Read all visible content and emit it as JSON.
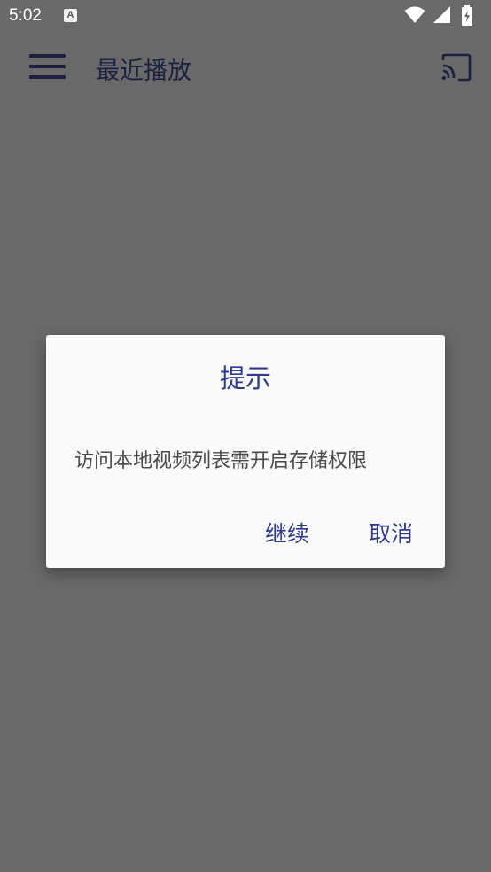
{
  "status_bar": {
    "time": "5:02",
    "notification_letter": "A",
    "icons": [
      "wifi-icon",
      "signal-icon",
      "battery-charging-icon"
    ]
  },
  "toolbar": {
    "title": "最近播放",
    "menu_icon": "hamburger-menu-icon",
    "cast_icon": "cast-icon"
  },
  "dialog": {
    "title": "提示",
    "message": "访问本地视频列表需开启存储权限",
    "continue_label": "继续",
    "cancel_label": "取消"
  },
  "colors": {
    "scrim_background": "#696969",
    "dialog_background": "#fafafa",
    "accent": "#2e3a8c",
    "toolbar_text": "#1b2040",
    "message_text": "#4a4a4a"
  }
}
